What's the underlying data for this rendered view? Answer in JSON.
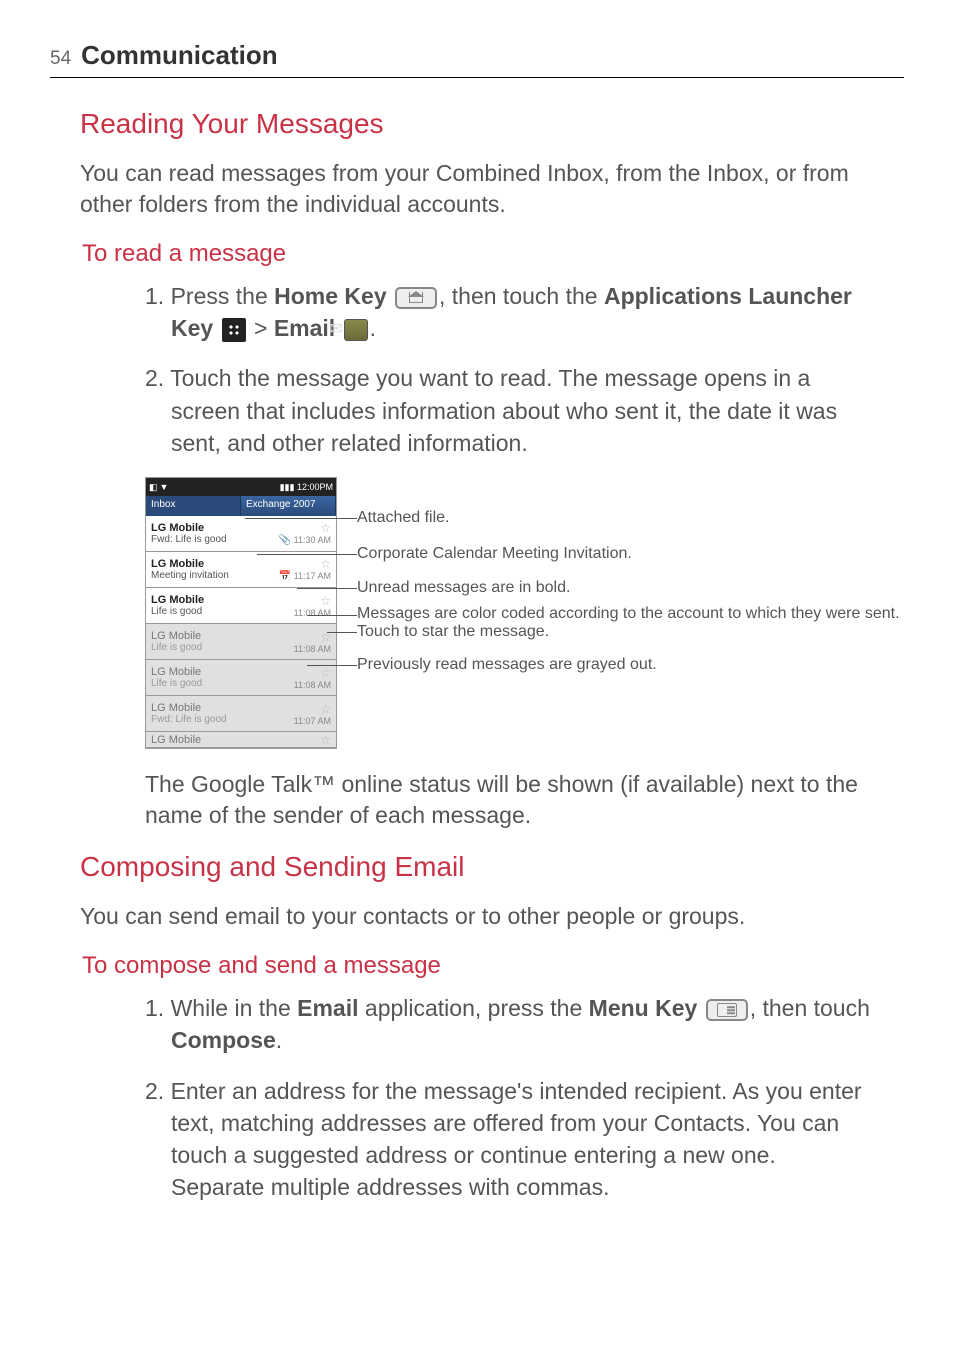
{
  "header": {
    "page_number": "54",
    "section": "Communication"
  },
  "h1": "Reading Your Messages",
  "p1": "You can read messages from your Combined Inbox, from the Inbox, or from other folders from the individual accounts.",
  "h2": "To read a message",
  "step1": {
    "num": "1.",
    "t1": "Press the ",
    "b1": "Home Key",
    "t2": ", then touch the ",
    "b2": "Applications Launcher Key",
    "t3": " > ",
    "b3": "Email",
    "t4": "."
  },
  "step2": {
    "num": "2.",
    "text": "Touch the message you want to read. The message opens in a screen that includes information about who sent it, the date it was sent, and other related information."
  },
  "screenshot": {
    "status_time": "12:00PM",
    "tabs": {
      "inbox": "Inbox",
      "exchange": "Exchange 2007"
    },
    "rows": [
      {
        "sender": "LG Mobile",
        "subject": "Fwd: Life is good",
        "time": "11:30 AM"
      },
      {
        "sender": "LG Mobile",
        "subject": "Meeting invitation",
        "time": "11:17 AM"
      },
      {
        "sender": "LG Mobile",
        "subject": "Life is good",
        "time": "11:08 AM"
      },
      {
        "sender": "LG Mobile",
        "subject": "Life is good",
        "time": "11:08 AM"
      },
      {
        "sender": "LG Mobile",
        "subject": "Life is good",
        "time": "11:08 AM"
      },
      {
        "sender": "LG Mobile",
        "subject": "Fwd: Life is good",
        "time": "11:07 AM"
      },
      {
        "sender": "LG Mobile",
        "subject": "",
        "time": ""
      }
    ],
    "callouts": {
      "c1": "Attached file.",
      "c2": "Corporate Calendar Meeting Invitation.",
      "c3": "Unread messages are in bold.",
      "c4": "Messages are color coded according to the account to which they were sent.",
      "c5": "Touch to star the message.",
      "c6": "Previously read messages are grayed out."
    }
  },
  "talk_note": "The Google Talk™ online status will be shown (if available) next to the name of the sender of each message.",
  "h3": "Composing and Sending Email",
  "p3": "You can send email to your contacts or to other people or groups.",
  "h4": "To compose and send a message",
  "comp_step1": {
    "num": "1.",
    "t1": "While in the ",
    "b1": "Email",
    "t2": " application, press the ",
    "b2": "Menu Key",
    "t3": ", then touch ",
    "b3": "Compose",
    "t4": "."
  },
  "comp_step2": {
    "num": "2.",
    "text": "Enter an address for the message's intended recipient. As you enter text, matching addresses are offered from your Contacts. You can touch a suggested address or continue entering a new one. Separate multiple addresses with commas."
  }
}
